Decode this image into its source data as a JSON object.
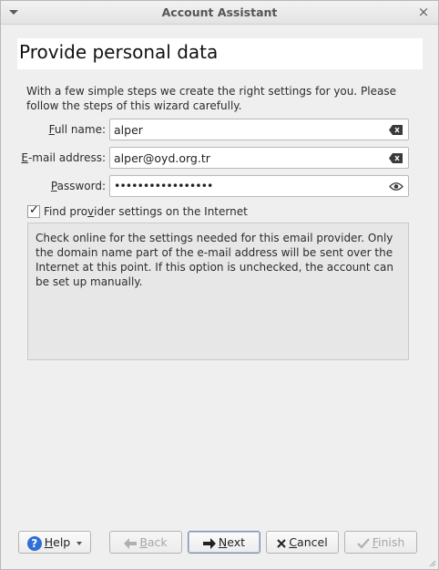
{
  "window": {
    "title": "Account Assistant"
  },
  "header": {
    "title": "Provide personal data"
  },
  "intro": "With a few simple steps we create the right settings for you. Please follow the steps of this wizard carefully.",
  "form": {
    "full_name": {
      "label_pre": "",
      "label_key": "F",
      "label_post": "ull name:",
      "value": "alper"
    },
    "email": {
      "label_pre": "",
      "label_key": "E",
      "label_post": "-mail address:",
      "value": "alper@oyd.org.tr"
    },
    "password": {
      "label_pre": "",
      "label_key": "P",
      "label_post": "assword:",
      "value": "•••••••••••••••••"
    }
  },
  "find_provider": {
    "checked": true,
    "label_pre": "Find pro",
    "label_key": "v",
    "label_post": "ider settings on the Internet"
  },
  "info_text": "Check online for the settings needed for this email provider. Only the domain name part of the e-mail address will be sent over the Internet at this point. If this option is unchecked, the account can be set up manually.",
  "buttons": {
    "help": {
      "key": "H",
      "rest": "elp"
    },
    "back": {
      "key": "B",
      "rest": "ack"
    },
    "next": {
      "key": "N",
      "rest": "ext"
    },
    "cancel": {
      "key": "C",
      "rest": "ancel"
    },
    "finish": {
      "key": "F",
      "rest": "inish"
    }
  },
  "icons": {
    "help": "question-circle-icon",
    "back": "arrow-left-icon",
    "next": "arrow-right-icon",
    "cancel": "x-icon",
    "finish": "checkmark-icon"
  }
}
